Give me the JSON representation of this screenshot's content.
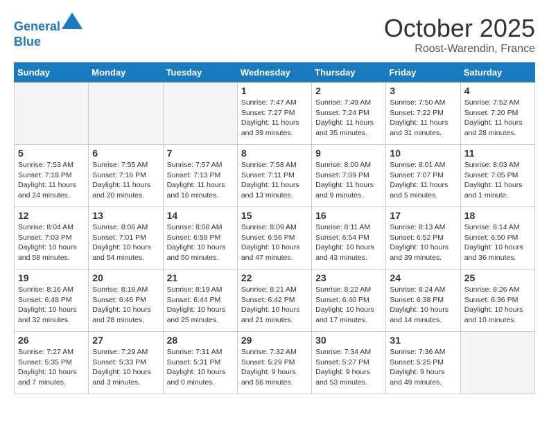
{
  "header": {
    "logo_line1": "General",
    "logo_line2": "Blue",
    "month": "October 2025",
    "location": "Roost-Warendin, France"
  },
  "weekdays": [
    "Sunday",
    "Monday",
    "Tuesday",
    "Wednesday",
    "Thursday",
    "Friday",
    "Saturday"
  ],
  "weeks": [
    [
      {
        "day": "",
        "info": "",
        "empty": true
      },
      {
        "day": "",
        "info": "",
        "empty": true
      },
      {
        "day": "",
        "info": "",
        "empty": true
      },
      {
        "day": "1",
        "info": "Sunrise: 7:47 AM\nSunset: 7:27 PM\nDaylight: 11 hours and 39 minutes."
      },
      {
        "day": "2",
        "info": "Sunrise: 7:49 AM\nSunset: 7:24 PM\nDaylight: 11 hours and 35 minutes."
      },
      {
        "day": "3",
        "info": "Sunrise: 7:50 AM\nSunset: 7:22 PM\nDaylight: 11 hours and 31 minutes."
      },
      {
        "day": "4",
        "info": "Sunrise: 7:52 AM\nSunset: 7:20 PM\nDaylight: 11 hours and 28 minutes."
      }
    ],
    [
      {
        "day": "5",
        "info": "Sunrise: 7:53 AM\nSunset: 7:18 PM\nDaylight: 11 hours and 24 minutes."
      },
      {
        "day": "6",
        "info": "Sunrise: 7:55 AM\nSunset: 7:16 PM\nDaylight: 11 hours and 20 minutes."
      },
      {
        "day": "7",
        "info": "Sunrise: 7:57 AM\nSunset: 7:13 PM\nDaylight: 11 hours and 16 minutes."
      },
      {
        "day": "8",
        "info": "Sunrise: 7:58 AM\nSunset: 7:11 PM\nDaylight: 11 hours and 13 minutes."
      },
      {
        "day": "9",
        "info": "Sunrise: 8:00 AM\nSunset: 7:09 PM\nDaylight: 11 hours and 9 minutes."
      },
      {
        "day": "10",
        "info": "Sunrise: 8:01 AM\nSunset: 7:07 PM\nDaylight: 11 hours and 5 minutes."
      },
      {
        "day": "11",
        "info": "Sunrise: 8:03 AM\nSunset: 7:05 PM\nDaylight: 11 hours and 1 minute."
      }
    ],
    [
      {
        "day": "12",
        "info": "Sunrise: 8:04 AM\nSunset: 7:03 PM\nDaylight: 10 hours and 58 minutes."
      },
      {
        "day": "13",
        "info": "Sunrise: 8:06 AM\nSunset: 7:01 PM\nDaylight: 10 hours and 54 minutes."
      },
      {
        "day": "14",
        "info": "Sunrise: 8:08 AM\nSunset: 6:59 PM\nDaylight: 10 hours and 50 minutes."
      },
      {
        "day": "15",
        "info": "Sunrise: 8:09 AM\nSunset: 6:56 PM\nDaylight: 10 hours and 47 minutes."
      },
      {
        "day": "16",
        "info": "Sunrise: 8:11 AM\nSunset: 6:54 PM\nDaylight: 10 hours and 43 minutes."
      },
      {
        "day": "17",
        "info": "Sunrise: 8:13 AM\nSunset: 6:52 PM\nDaylight: 10 hours and 39 minutes."
      },
      {
        "day": "18",
        "info": "Sunrise: 8:14 AM\nSunset: 6:50 PM\nDaylight: 10 hours and 36 minutes."
      }
    ],
    [
      {
        "day": "19",
        "info": "Sunrise: 8:16 AM\nSunset: 6:48 PM\nDaylight: 10 hours and 32 minutes."
      },
      {
        "day": "20",
        "info": "Sunrise: 8:18 AM\nSunset: 6:46 PM\nDaylight: 10 hours and 28 minutes."
      },
      {
        "day": "21",
        "info": "Sunrise: 8:19 AM\nSunset: 6:44 PM\nDaylight: 10 hours and 25 minutes."
      },
      {
        "day": "22",
        "info": "Sunrise: 8:21 AM\nSunset: 6:42 PM\nDaylight: 10 hours and 21 minutes."
      },
      {
        "day": "23",
        "info": "Sunrise: 8:22 AM\nSunset: 6:40 PM\nDaylight: 10 hours and 17 minutes."
      },
      {
        "day": "24",
        "info": "Sunrise: 8:24 AM\nSunset: 6:38 PM\nDaylight: 10 hours and 14 minutes."
      },
      {
        "day": "25",
        "info": "Sunrise: 8:26 AM\nSunset: 6:36 PM\nDaylight: 10 hours and 10 minutes."
      }
    ],
    [
      {
        "day": "26",
        "info": "Sunrise: 7:27 AM\nSunset: 5:35 PM\nDaylight: 10 hours and 7 minutes."
      },
      {
        "day": "27",
        "info": "Sunrise: 7:29 AM\nSunset: 5:33 PM\nDaylight: 10 hours and 3 minutes."
      },
      {
        "day": "28",
        "info": "Sunrise: 7:31 AM\nSunset: 5:31 PM\nDaylight: 10 hours and 0 minutes."
      },
      {
        "day": "29",
        "info": "Sunrise: 7:32 AM\nSunset: 5:29 PM\nDaylight: 9 hours and 56 minutes."
      },
      {
        "day": "30",
        "info": "Sunrise: 7:34 AM\nSunset: 5:27 PM\nDaylight: 9 hours and 53 minutes."
      },
      {
        "day": "31",
        "info": "Sunrise: 7:36 AM\nSunset: 5:25 PM\nDaylight: 9 hours and 49 minutes."
      },
      {
        "day": "",
        "info": "",
        "empty": true
      }
    ]
  ]
}
